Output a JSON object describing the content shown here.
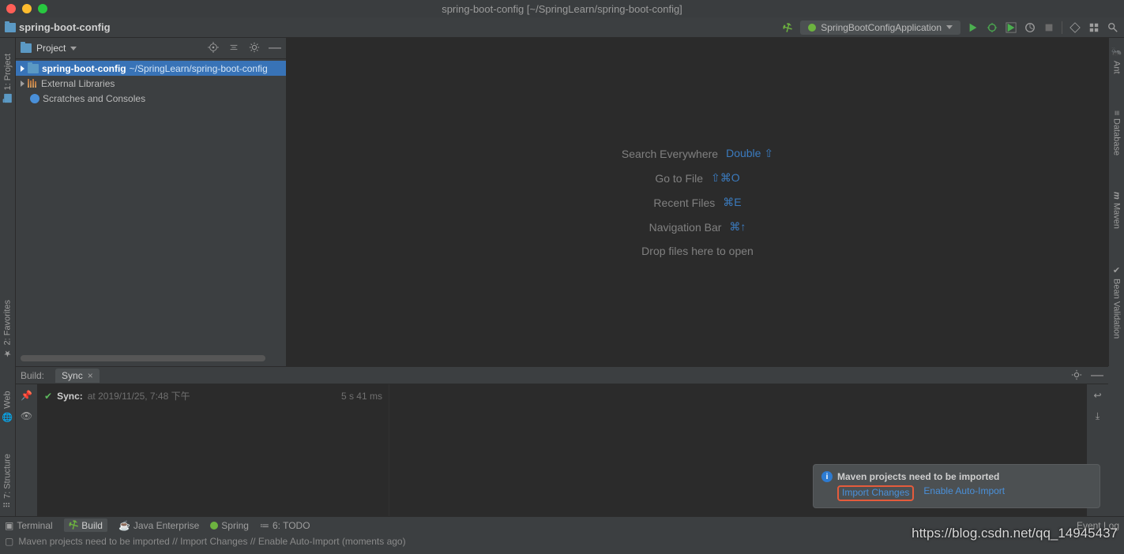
{
  "window": {
    "title": "spring-boot-config [~/SpringLearn/spring-boot-config]"
  },
  "breadcrumb": {
    "project": "spring-boot-config"
  },
  "run": {
    "config": "SpringBootConfigApplication"
  },
  "project_panel": {
    "title": "Project",
    "items": [
      {
        "name": "spring-boot-config",
        "path": "~/SpringLearn/spring-boot-config"
      },
      {
        "name": "External Libraries"
      },
      {
        "name": "Scratches and Consoles"
      }
    ]
  },
  "hints": {
    "search": {
      "label": "Search Everywhere",
      "key": "Double ⇧"
    },
    "goto": {
      "label": "Go to File",
      "key": "⇧⌘O"
    },
    "recent": {
      "label": "Recent Files",
      "key": "⌘E"
    },
    "nav": {
      "label": "Navigation Bar",
      "key": "⌘↑"
    },
    "drop": {
      "label": "Drop files here to open"
    }
  },
  "build": {
    "header_label": "Build:",
    "tab": "Sync",
    "sync_label": "Sync:",
    "sync_time": "at 2019/11/25, 7:48 下午",
    "duration": "5 s 41 ms"
  },
  "popup": {
    "title": "Maven projects need to be imported",
    "import": "Import Changes",
    "auto": "Enable Auto-Import"
  },
  "status_tabs": {
    "terminal": "Terminal",
    "build": "Build",
    "java_ee": "Java Enterprise",
    "spring": "Spring",
    "todo": "6: TODO"
  },
  "status_msg": "Maven projects need to be imported // Import Changes // Enable Auto-Import (moments ago)",
  "event_log": "Event Log",
  "left_tool": {
    "project": "1: Project",
    "favorites": "2: Favorites",
    "web": "Web",
    "structure": "7: Structure"
  },
  "right_tool": {
    "ant": "Ant",
    "database": "Database",
    "maven": "Maven",
    "bean": "Bean Validation"
  },
  "watermark": "https://blog.csdn.net/qq_14945437",
  "glyph": {
    "m": "m"
  }
}
